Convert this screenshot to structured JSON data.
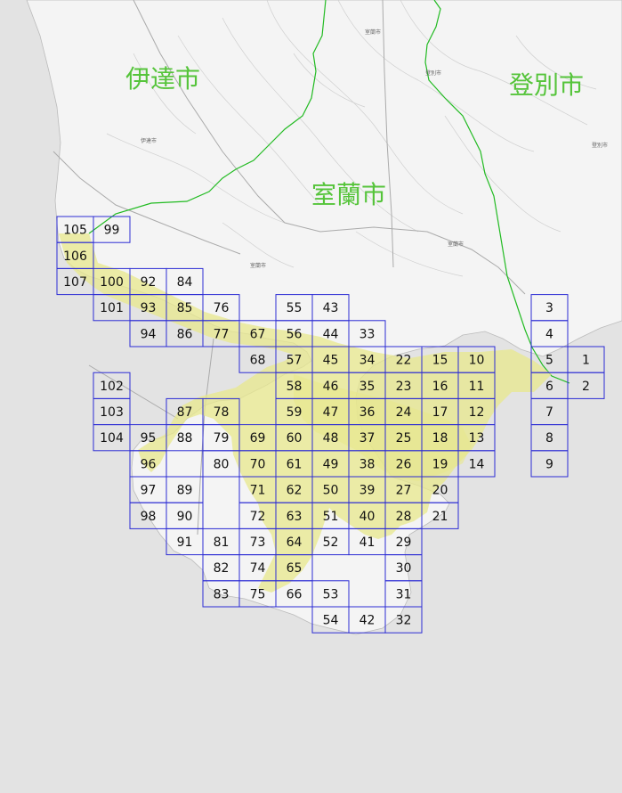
{
  "map": {
    "cities": [
      {
        "name": "伊達市",
        "key": "date"
      },
      {
        "name": "室蘭市",
        "key": "muroran"
      },
      {
        "name": "登別市",
        "key": "noboribetsu"
      }
    ],
    "small_labels": [
      "室蘭市",
      "伊達市",
      "室蘭市",
      "登別市",
      "登別市",
      "室蘭市"
    ],
    "colors": {
      "background": "#e3e3e3",
      "land": "#f2f2f2",
      "sea": "#dcdcdc",
      "boundary": "#22bb22",
      "city_label": "#55c43a",
      "grid": "#2b2bd4",
      "highlight": "#e8e88c"
    },
    "tiles": [
      {
        "label": "105",
        "col": 0,
        "row": 0
      },
      {
        "label": "99",
        "col": 1,
        "row": 0
      },
      {
        "label": "106",
        "col": 0,
        "row": 1
      },
      {
        "label": "107",
        "col": 0,
        "row": 2
      },
      {
        "label": "100",
        "col": 1,
        "row": 2
      },
      {
        "label": "92",
        "col": 2,
        "row": 2
      },
      {
        "label": "84",
        "col": 3,
        "row": 2
      },
      {
        "label": "101",
        "col": 1,
        "row": 3
      },
      {
        "label": "93",
        "col": 2,
        "row": 3
      },
      {
        "label": "85",
        "col": 3,
        "row": 3
      },
      {
        "label": "76",
        "col": 4,
        "row": 3
      },
      {
        "label": "55",
        "col": 6,
        "row": 3
      },
      {
        "label": "43",
        "col": 7,
        "row": 3
      },
      {
        "label": "3",
        "col": 13,
        "row": 3
      },
      {
        "label": "94",
        "col": 2,
        "row": 4
      },
      {
        "label": "86",
        "col": 3,
        "row": 4
      },
      {
        "label": "77",
        "col": 4,
        "row": 4
      },
      {
        "label": "67",
        "col": 5,
        "row": 4
      },
      {
        "label": "56",
        "col": 6,
        "row": 4
      },
      {
        "label": "44",
        "col": 7,
        "row": 4
      },
      {
        "label": "33",
        "col": 8,
        "row": 4
      },
      {
        "label": "4",
        "col": 13,
        "row": 4
      },
      {
        "label": "68",
        "col": 5,
        "row": 5
      },
      {
        "label": "57",
        "col": 6,
        "row": 5
      },
      {
        "label": "45",
        "col": 7,
        "row": 5
      },
      {
        "label": "34",
        "col": 8,
        "row": 5
      },
      {
        "label": "22",
        "col": 9,
        "row": 5
      },
      {
        "label": "15",
        "col": 10,
        "row": 5
      },
      {
        "label": "10",
        "col": 11,
        "row": 5
      },
      {
        "label": "5",
        "col": 13,
        "row": 5
      },
      {
        "label": "1",
        "col": 14,
        "row": 5
      },
      {
        "label": "102",
        "col": 1,
        "row": 6
      },
      {
        "label": "58",
        "col": 6,
        "row": 6
      },
      {
        "label": "46",
        "col": 7,
        "row": 6
      },
      {
        "label": "35",
        "col": 8,
        "row": 6
      },
      {
        "label": "23",
        "col": 9,
        "row": 6
      },
      {
        "label": "16",
        "col": 10,
        "row": 6
      },
      {
        "label": "11",
        "col": 11,
        "row": 6
      },
      {
        "label": "6",
        "col": 13,
        "row": 6
      },
      {
        "label": "2",
        "col": 14,
        "row": 6
      },
      {
        "label": "103",
        "col": 1,
        "row": 7
      },
      {
        "label": "87",
        "col": 3,
        "row": 7
      },
      {
        "label": "78",
        "col": 4,
        "row": 7
      },
      {
        "label": "59",
        "col": 6,
        "row": 7
      },
      {
        "label": "47",
        "col": 7,
        "row": 7
      },
      {
        "label": "36",
        "col": 8,
        "row": 7
      },
      {
        "label": "24",
        "col": 9,
        "row": 7
      },
      {
        "label": "17",
        "col": 10,
        "row": 7
      },
      {
        "label": "12",
        "col": 11,
        "row": 7
      },
      {
        "label": "7",
        "col": 13,
        "row": 7
      },
      {
        "label": "104",
        "col": 1,
        "row": 8
      },
      {
        "label": "95",
        "col": 2,
        "row": 8
      },
      {
        "label": "88",
        "col": 3,
        "row": 8
      },
      {
        "label": "79",
        "col": 4,
        "row": 8
      },
      {
        "label": "69",
        "col": 5,
        "row": 8
      },
      {
        "label": "60",
        "col": 6,
        "row": 8
      },
      {
        "label": "48",
        "col": 7,
        "row": 8
      },
      {
        "label": "37",
        "col": 8,
        "row": 8
      },
      {
        "label": "25",
        "col": 9,
        "row": 8
      },
      {
        "label": "18",
        "col": 10,
        "row": 8
      },
      {
        "label": "13",
        "col": 11,
        "row": 8
      },
      {
        "label": "8",
        "col": 13,
        "row": 8
      },
      {
        "label": "96",
        "col": 2,
        "row": 9
      },
      {
        "label": "80",
        "col": 4,
        "row": 9
      },
      {
        "label": "70",
        "col": 5,
        "row": 9
      },
      {
        "label": "61",
        "col": 6,
        "row": 9
      },
      {
        "label": "49",
        "col": 7,
        "row": 9
      },
      {
        "label": "38",
        "col": 8,
        "row": 9
      },
      {
        "label": "26",
        "col": 9,
        "row": 9
      },
      {
        "label": "19",
        "col": 10,
        "row": 9
      },
      {
        "label": "14",
        "col": 11,
        "row": 9
      },
      {
        "label": "9",
        "col": 13,
        "row": 9
      },
      {
        "label": "97",
        "col": 2,
        "row": 10
      },
      {
        "label": "89",
        "col": 3,
        "row": 10
      },
      {
        "label": "71",
        "col": 5,
        "row": 10
      },
      {
        "label": "62",
        "col": 6,
        "row": 10
      },
      {
        "label": "50",
        "col": 7,
        "row": 10
      },
      {
        "label": "39",
        "col": 8,
        "row": 10
      },
      {
        "label": "27",
        "col": 9,
        "row": 10
      },
      {
        "label": "20",
        "col": 10,
        "row": 10
      },
      {
        "label": "98",
        "col": 2,
        "row": 11
      },
      {
        "label": "90",
        "col": 3,
        "row": 11
      },
      {
        "label": "72",
        "col": 5,
        "row": 11
      },
      {
        "label": "63",
        "col": 6,
        "row": 11
      },
      {
        "label": "51",
        "col": 7,
        "row": 11
      },
      {
        "label": "40",
        "col": 8,
        "row": 11
      },
      {
        "label": "28",
        "col": 9,
        "row": 11
      },
      {
        "label": "21",
        "col": 10,
        "row": 11
      },
      {
        "label": "91",
        "col": 3,
        "row": 12
      },
      {
        "label": "81",
        "col": 4,
        "row": 12
      },
      {
        "label": "73",
        "col": 5,
        "row": 12
      },
      {
        "label": "64",
        "col": 6,
        "row": 12
      },
      {
        "label": "52",
        "col": 7,
        "row": 12
      },
      {
        "label": "41",
        "col": 8,
        "row": 12
      },
      {
        "label": "29",
        "col": 9,
        "row": 12
      },
      {
        "label": "82",
        "col": 4,
        "row": 13
      },
      {
        "label": "74",
        "col": 5,
        "row": 13
      },
      {
        "label": "65",
        "col": 6,
        "row": 13
      },
      {
        "label": "30",
        "col": 9,
        "row": 13
      },
      {
        "label": "83",
        "col": 4,
        "row": 14
      },
      {
        "label": "75",
        "col": 5,
        "row": 14
      },
      {
        "label": "66",
        "col": 6,
        "row": 14
      },
      {
        "label": "53",
        "col": 7,
        "row": 14
      },
      {
        "label": "31",
        "col": 9,
        "row": 14
      },
      {
        "label": "54",
        "col": 7,
        "row": 15
      },
      {
        "label": "42",
        "col": 8,
        "row": 15
      },
      {
        "label": "32",
        "col": 9,
        "row": 15
      }
    ]
  }
}
